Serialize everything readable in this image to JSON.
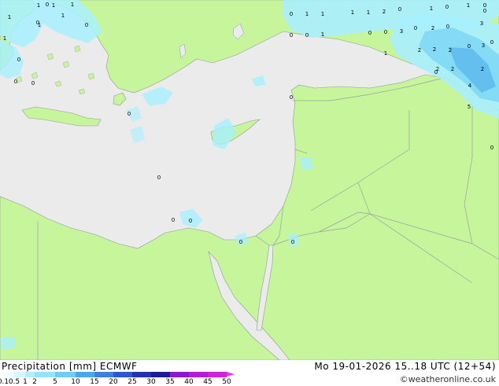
{
  "map": {
    "colors": {
      "sea": "#ebebeb",
      "land": "#c6f59c",
      "border": "#9aa0a6",
      "coast": "#8f9a95",
      "precip_light": "#a8f0ff",
      "precip_mid": "#7fd8f5",
      "precip_heavy": "#5cb8ec"
    },
    "labels": [
      {
        "text": "1",
        "id": "a1"
      },
      {
        "text": "1",
        "id": "a2"
      },
      {
        "text": "1",
        "id": "a3"
      },
      {
        "text": "0",
        "id": "a4"
      },
      {
        "text": "1",
        "id": "a5"
      },
      {
        "text": "1",
        "id": "a6"
      },
      {
        "text": "0",
        "id": "a7"
      },
      {
        "text": "0",
        "id": "a8"
      },
      {
        "text": "0",
        "id": "a9"
      },
      {
        "text": "0",
        "id": "a10"
      },
      {
        "text": "1",
        "id": "a11"
      },
      {
        "text": "1",
        "id": "a12"
      },
      {
        "text": "0",
        "id": "a13"
      },
      {
        "text": "1",
        "id": "a14"
      },
      {
        "text": "1",
        "id": "a15"
      },
      {
        "text": "1",
        "id": "a16"
      },
      {
        "text": "1",
        "id": "a17"
      },
      {
        "text": "2",
        "id": "a18"
      },
      {
        "text": "0",
        "id": "a19"
      },
      {
        "text": "1",
        "id": "a20"
      },
      {
        "text": "0",
        "id": "a21"
      },
      {
        "text": "1",
        "id": "a22"
      },
      {
        "text": "0",
        "id": "a23"
      },
      {
        "text": "0",
        "id": "a24"
      },
      {
        "text": "0",
        "id": "a25"
      },
      {
        "text": "1",
        "id": "a26"
      },
      {
        "text": "0",
        "id": "a27"
      },
      {
        "text": "0",
        "id": "a28"
      },
      {
        "text": "3",
        "id": "a29"
      },
      {
        "text": "0",
        "id": "a30"
      },
      {
        "text": "2",
        "id": "a31"
      },
      {
        "text": "0",
        "id": "a32"
      },
      {
        "text": "3",
        "id": "a33"
      },
      {
        "text": "0",
        "id": "a34"
      },
      {
        "text": "1",
        "id": "a35"
      },
      {
        "text": "2",
        "id": "a36"
      },
      {
        "text": "2",
        "id": "a37"
      },
      {
        "text": "2",
        "id": "a38"
      },
      {
        "text": "0",
        "id": "a39"
      },
      {
        "text": "3",
        "id": "a40"
      },
      {
        "text": "2",
        "id": "a41"
      },
      {
        "text": "2",
        "id": "a42"
      },
      {
        "text": "4",
        "id": "a43"
      },
      {
        "text": "2",
        "id": "a44"
      },
      {
        "text": "5",
        "id": "a45"
      },
      {
        "text": "0",
        "id": "a46"
      },
      {
        "text": "0",
        "id": "a47"
      },
      {
        "text": "0",
        "id": "a48"
      },
      {
        "text": "0",
        "id": "a49"
      },
      {
        "text": "0",
        "id": "a50"
      },
      {
        "text": "0",
        "id": "a51"
      },
      {
        "text": "0",
        "id": "a52"
      },
      {
        "text": "0",
        "id": "a53"
      },
      {
        "text": "0",
        "id": "a54"
      },
      {
        "text": "0",
        "id": "a55"
      },
      {
        "text": "0",
        "id": "a56"
      }
    ]
  },
  "footer": {
    "title": "Precipitation [mm] ECMWF",
    "datetime": "Mo 19-01-2026 15..18 UTC (12+54)",
    "credit": "©weatheronline.co.uk",
    "scale": [
      {
        "label": "0.1",
        "color": "#f0fbff"
      },
      {
        "label": "0.5",
        "color": "#d8f6ff"
      },
      {
        "label": "1",
        "color": "#b8eefc"
      },
      {
        "label": "2",
        "color": "#96e2f8"
      },
      {
        "label": "5",
        "color": "#70cdf2"
      },
      {
        "label": "10",
        "color": "#4aa8ea"
      },
      {
        "label": "15",
        "color": "#3f7fe0"
      },
      {
        "label": "20",
        "color": "#2e55d2"
      },
      {
        "label": "25",
        "color": "#2431b4"
      },
      {
        "label": "30",
        "color": "#1c1a96"
      },
      {
        "label": "35",
        "color": "#8a18d6"
      },
      {
        "label": "40",
        "color": "#b21cd8"
      },
      {
        "label": "45",
        "color": "#d420d8"
      },
      {
        "label": "50",
        "color": "#ee33ee"
      }
    ]
  }
}
